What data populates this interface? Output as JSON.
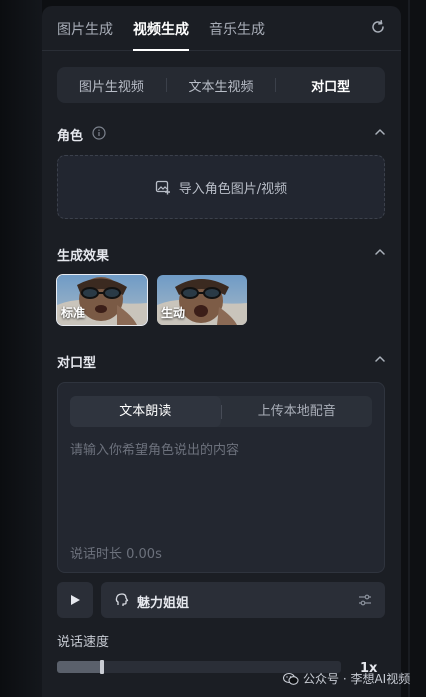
{
  "top_tabs": [
    {
      "label": "图片生成",
      "active": false
    },
    {
      "label": "视频生成",
      "active": true
    },
    {
      "label": "音乐生成",
      "active": false
    }
  ],
  "mode_tabs": [
    {
      "label": "图片生视频",
      "active": false
    },
    {
      "label": "文本生视频",
      "active": false
    },
    {
      "label": "对口型",
      "active": true
    }
  ],
  "role": {
    "title": "角色",
    "upload_label": "导入角色图片/视频"
  },
  "effect": {
    "title": "生成效果",
    "options": [
      {
        "label": "标准",
        "selected": true
      },
      {
        "label": "生动",
        "selected": false
      }
    ]
  },
  "lipsync": {
    "title": "对口型",
    "tabs": [
      {
        "label": "文本朗读",
        "active": true
      },
      {
        "label": "上传本地配音",
        "active": false
      }
    ],
    "placeholder": "请输入你希望角色说出的内容",
    "duration_text": "说话时长 0.00s"
  },
  "voice": {
    "name": "魅力姐姐"
  },
  "speed": {
    "label": "说话速度",
    "value_text": "1x",
    "level": 0.16
  },
  "watermark": {
    "text": "公众号 · 李想AI视频"
  },
  "colors": {
    "panel_bg": "#1b1e24",
    "accent": "#ffffff"
  }
}
